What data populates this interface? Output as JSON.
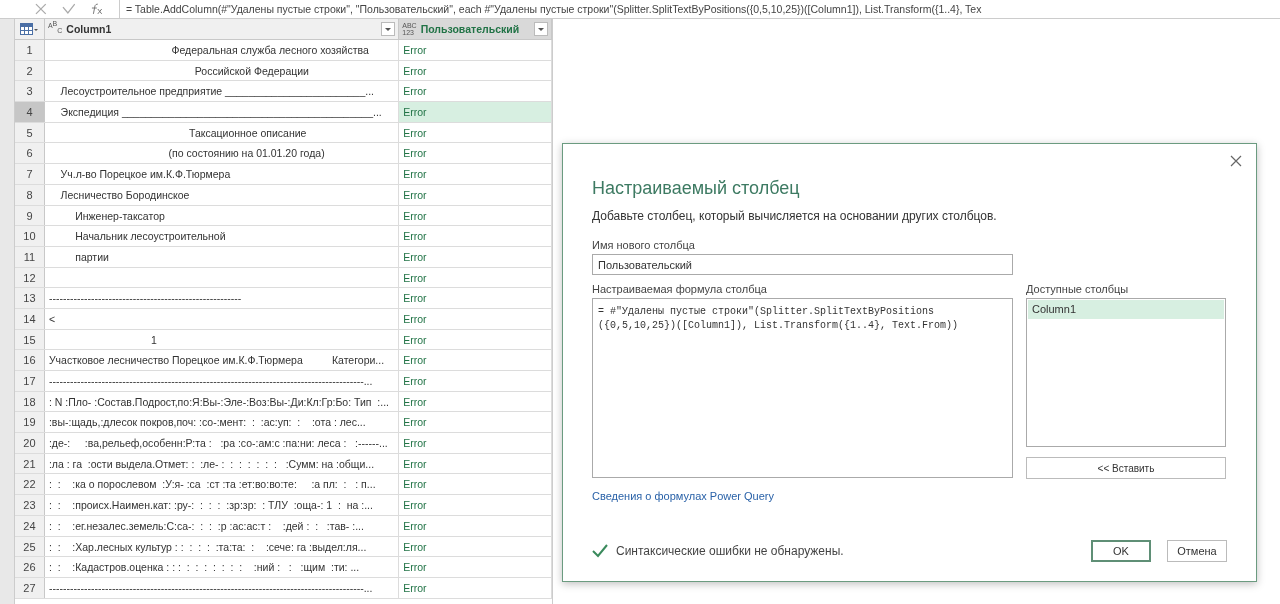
{
  "formula_bar": {
    "formula": "= Table.AddColumn(#\"Удалены пустые строки\", \"Пользовательский\", each #\"Удалены пустые строки\"(Splitter.SplitTextByPositions({0,5,10,25})([Column1]), List.Transform({1..4}, Tex"
  },
  "table": {
    "columns": [
      {
        "name": "Column1",
        "kind": "text",
        "type_label": [
          "ABC"
        ],
        "selected": false
      },
      {
        "name": "Пользовательский",
        "kind": "any",
        "type_label": [
          "ABC",
          "123"
        ],
        "selected": true
      }
    ],
    "rows": [
      {
        "number": "1",
        "column1": "                                          Федеральная служба лесного хозяйства",
        "custom": "Error",
        "selected": false
      },
      {
        "number": "2",
        "column1": "                                                  Российской Федерации",
        "custom": "Error",
        "selected": false
      },
      {
        "number": "3",
        "column1": "    Лесоустроительное предприятие ________________________...",
        "custom": "Error",
        "selected": false
      },
      {
        "number": "4",
        "column1": "    Экспедиция ___________________________________________...",
        "custom": "Error",
        "selected": true
      },
      {
        "number": "5",
        "column1": "                                                Таксационное описание",
        "custom": "Error",
        "selected": false
      },
      {
        "number": "6",
        "column1": "                                         (по состоянию на 01.01.20 года)",
        "custom": "Error",
        "selected": false
      },
      {
        "number": "7",
        "column1": "    Уч.л-во Порецкое им.К.Ф.Тюрмера",
        "custom": "Error",
        "selected": false
      },
      {
        "number": "8",
        "column1": "    Лесничество Бородинское",
        "custom": "Error",
        "selected": false
      },
      {
        "number": "9",
        "column1": "         Инженер-таксатор",
        "custom": "Error",
        "selected": false
      },
      {
        "number": "10",
        "column1": "         Начальник лесоустроительной",
        "custom": "Error",
        "selected": false
      },
      {
        "number": "11",
        "column1": "         партии",
        "custom": "Error",
        "selected": false
      },
      {
        "number": "12",
        "column1": "",
        "custom": "Error",
        "selected": false
      },
      {
        "number": "13",
        "column1": "-------------------------------------------------------",
        "custom": "Error",
        "selected": false
      },
      {
        "number": "14",
        "column1": "<",
        "custom": "Error",
        "selected": false
      },
      {
        "number": "15",
        "column1": "                                   1",
        "custom": "Error",
        "selected": false
      },
      {
        "number": "16",
        "column1": "Участковое лесничество Порецкое им.К.Ф.Тюрмера          Категори...",
        "custom": "Error",
        "selected": false
      },
      {
        "number": "17",
        "column1": "------------------------------------------------------------------------------------------...",
        "custom": "Error",
        "selected": false
      },
      {
        "number": "18",
        "column1": ": N :Пло- :Состав.Подрост,по:Я:Вы-:Эле-:Воз:Вы-:Ди:Кл:Гр:Бо: Тип  :...",
        "custom": "Error",
        "selected": false
      },
      {
        "number": "19",
        "column1": ":вы-:щадь,:длесок покров,поч: :со-:мент:  :  :ас:уп:  :    :ота : лес...",
        "custom": "Error",
        "selected": false
      },
      {
        "number": "20",
        "column1": ":де-:     :ва,рельеф,особенн:Р:та :   :ра :со-:ам:с :па:ни: леса :   :------...",
        "custom": "Error",
        "selected": false
      },
      {
        "number": "21",
        "column1": ":ла : га  :ости выдела.Отмет: :  :ле- :  :  :  :  :  :  :   :Сумм: на :общи...",
        "custom": "Error",
        "selected": false
      },
      {
        "number": "22",
        "column1": ":  :    :ка о порослевом  :У:я- :са  :ст :та :ет:во:во:те:     :а пл:  :   : п...",
        "custom": "Error",
        "selected": false
      },
      {
        "number": "23",
        "column1": ":  :    :происх.Наимен.кат: :ру-:  :  :  :  :зр:зр:  : ТЛУ  :оща-: 1  :  на :...",
        "custom": "Error",
        "selected": false
      },
      {
        "number": "24",
        "column1": ":  :    :ег.незалес.земель:С:са-:  :  :  :р :ас:ас:т :    :дей :  :   :тав- :...",
        "custom": "Error",
        "selected": false
      },
      {
        "number": "25",
        "column1": ":  :    :Хар.лесных культур : :  :  :  :  :та:та:  :    :сече: га :выдел:ля...",
        "custom": "Error",
        "selected": false
      },
      {
        "number": "26",
        "column1": ":  :    :Кадастров.оценка : : :  :  :  :  :  :  :  :    :ний :   :   :щим  :ти: ...",
        "custom": "Error",
        "selected": false
      },
      {
        "number": "27",
        "column1": "------------------------------------------------------------------------------------------...",
        "custom": "Error",
        "selected": false
      }
    ]
  },
  "dialog": {
    "title": "Настраиваемый столбец",
    "description": "Добавьте столбец, который вычисляется на основании других столбцов.",
    "name_label": "Имя нового столбца",
    "name_value": "Пользовательский",
    "formula_label": "Настраиваемая формула столбца",
    "formula_value": "= #\"Удалены пустые строки\"(Splitter.SplitTextByPositions\n({0,5,10,25})([Column1]), List.Transform({1..4}, Text.From))",
    "columns_label": "Доступные столбцы",
    "available_columns": [
      {
        "name": "Column1",
        "selected": true
      }
    ],
    "insert_button": "<< Вставить",
    "help_link": "Сведения о формулах Power Query",
    "status": "Синтаксические ошибки не обнаружены.",
    "ok_button": "OK",
    "cancel_button": "Отмена"
  }
}
